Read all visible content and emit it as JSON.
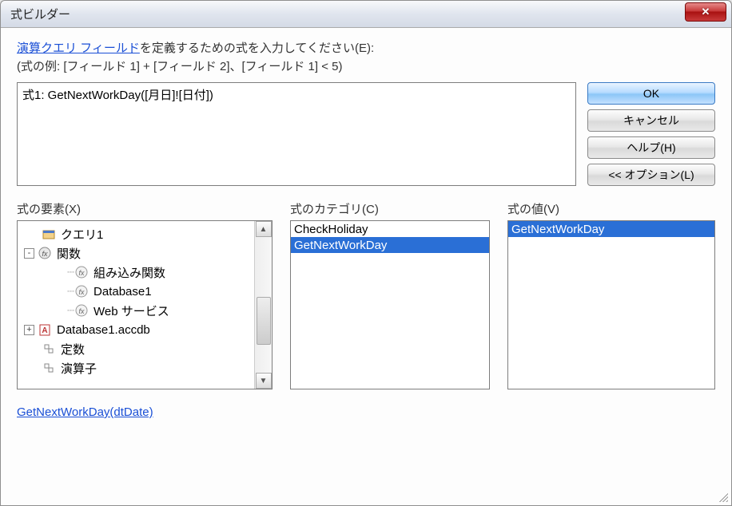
{
  "window": {
    "title": "式ビルダー"
  },
  "header": {
    "link_text": "演算クエリ フィールド",
    "instruction_tail": "を定義するための式を入力してください(E):",
    "example": "(式の例: [フィールド 1] + [フィールド 2]、[フィールド 1] < 5)"
  },
  "expression": "式1: GetNextWorkDay([月日]![日付])",
  "buttons": {
    "ok": "OK",
    "cancel": "キャンセル",
    "help": "ヘルプ(H)",
    "options": "<< オプション(L)"
  },
  "labels": {
    "elements": "式の要素(X)",
    "category": "式のカテゴリ(C)",
    "value": "式の値(V)"
  },
  "tree": {
    "items": [
      {
        "icon": "query",
        "label": "クエリ1"
      },
      {
        "icon": "fx",
        "label": "関数",
        "expand": "-"
      },
      {
        "icon": "fx",
        "label": "組み込み関数"
      },
      {
        "icon": "fx",
        "label": "Database1"
      },
      {
        "icon": "fx",
        "label": "Web サービス"
      },
      {
        "icon": "acc",
        "label": "Database1.accdb",
        "expand": "+"
      },
      {
        "icon": "const",
        "label": "定数"
      },
      {
        "icon": "const",
        "label": "演算子"
      }
    ]
  },
  "category_list": [
    "CheckHoliday",
    "GetNextWorkDay"
  ],
  "category_selected": 1,
  "value_list": [
    "GetNextWorkDay"
  ],
  "value_selected": 0,
  "footer_link": "GetNextWorkDay(dtDate)"
}
